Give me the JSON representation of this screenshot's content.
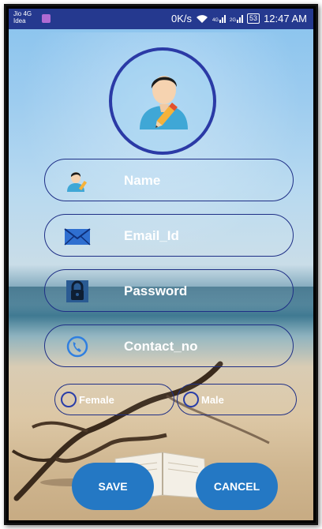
{
  "status_bar": {
    "carrier_line1": "Jio 4G",
    "carrier_line2": "Idea",
    "data_speed": "0K/s",
    "signal1_tech": "4G",
    "signal2_tech": "2G",
    "battery": "53",
    "time": "12:47 AM"
  },
  "avatar": {
    "icon": "user-edit-icon"
  },
  "form": {
    "name": {
      "placeholder": "Name",
      "icon": "user-edit-icon"
    },
    "email": {
      "placeholder": "Email_Id",
      "icon": "envelope-icon"
    },
    "password": {
      "placeholder": "Password",
      "icon": "lock-icon"
    },
    "contact": {
      "placeholder": "Contact_no",
      "icon": "phone-icon"
    },
    "gender": {
      "female_label": "Female",
      "male_label": "Male"
    }
  },
  "buttons": {
    "save_label": "SAVE",
    "cancel_label": "CANCEL"
  },
  "colors": {
    "status_bar": "#25398f",
    "accent_border": "#1f2f86",
    "button": "#2478c4"
  }
}
